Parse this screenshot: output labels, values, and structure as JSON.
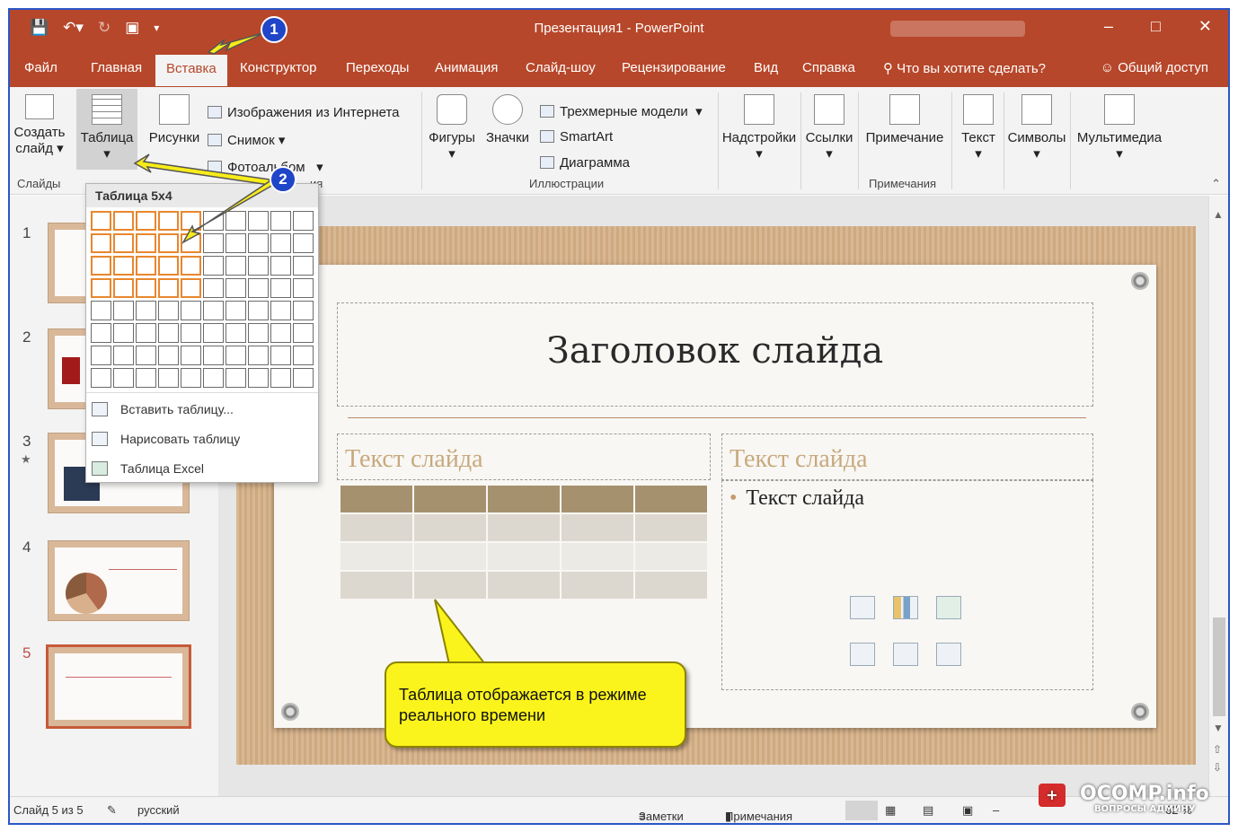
{
  "window": {
    "title": "Презентация1  -  PowerPoint",
    "qat_icons": [
      "save-icon",
      "undo-icon",
      "redo-icon",
      "present-icon",
      "customize-icon"
    ],
    "controls": [
      "minimize-icon",
      "maximize-icon",
      "close-icon"
    ]
  },
  "tabs": [
    {
      "label": "Файл"
    },
    {
      "label": "Главная"
    },
    {
      "label": "Вставка"
    },
    {
      "label": "Конструктор"
    },
    {
      "label": "Переходы"
    },
    {
      "label": "Анимация"
    },
    {
      "label": "Слайд-шоу"
    },
    {
      "label": "Рецензирование"
    },
    {
      "label": "Вид"
    },
    {
      "label": "Справка"
    }
  ],
  "tell_me": "Что вы хотите сделать?",
  "share": "Общий доступ",
  "ribbon": {
    "new_slide_1": "Создать",
    "new_slide_2": "слайд",
    "table": "Таблица",
    "pictures": "Рисунки",
    "online_pictures": "Изображения из Интернета",
    "screenshot": "Снимок",
    "photo_album": "Фотоальбом",
    "shapes": "Фигуры",
    "icons": "Значки",
    "models_3d": "Трехмерные модели",
    "smartart": "SmartArt",
    "chart": "Диаграмма",
    "addins": "Надстройки",
    "links": "Ссылки",
    "comment": "Примечание",
    "text": "Текст",
    "symbols": "Символы",
    "media": "Мультимедиа",
    "groups": {
      "slides": "Слайды",
      "images_tail": "ия",
      "illustrations": "Иллюстрации",
      "comments": "Примечания"
    }
  },
  "table_dropdown": {
    "title": "Таблица 5x4",
    "cols": 10,
    "rows": 8,
    "selected_cols": 5,
    "selected_rows": 4,
    "insert_table": "Вставить таблицу...",
    "draw_table": "Нарисовать таблицу",
    "excel_table": "Таблица Excel"
  },
  "thumbnails": [
    {
      "num": "1"
    },
    {
      "num": "2"
    },
    {
      "num": "3"
    },
    {
      "num": "4"
    },
    {
      "num": "5"
    }
  ],
  "slide": {
    "title": "Заголовок слайда",
    "left_head": "Текст слайда",
    "right_head": "Текст слайда",
    "bullet": "Текст слайда"
  },
  "callout": "Таблица отображается в режиме реального времени",
  "annotations": {
    "badge1": "1",
    "badge2": "2"
  },
  "status": {
    "slide_info": "Слайд 5 из 5",
    "language": "русский",
    "notes": "Заметки",
    "comments": "Примечания",
    "zoom_value": "62 %"
  },
  "watermark": {
    "brand": "OCOMP.info",
    "tagline": "ВОПРОСЫ АДМИНУ"
  },
  "colors": {
    "accent": "#b7472a",
    "callout": "#fbf41c",
    "grid_highlight": "#e8872e",
    "badge": "#1f45c8"
  }
}
